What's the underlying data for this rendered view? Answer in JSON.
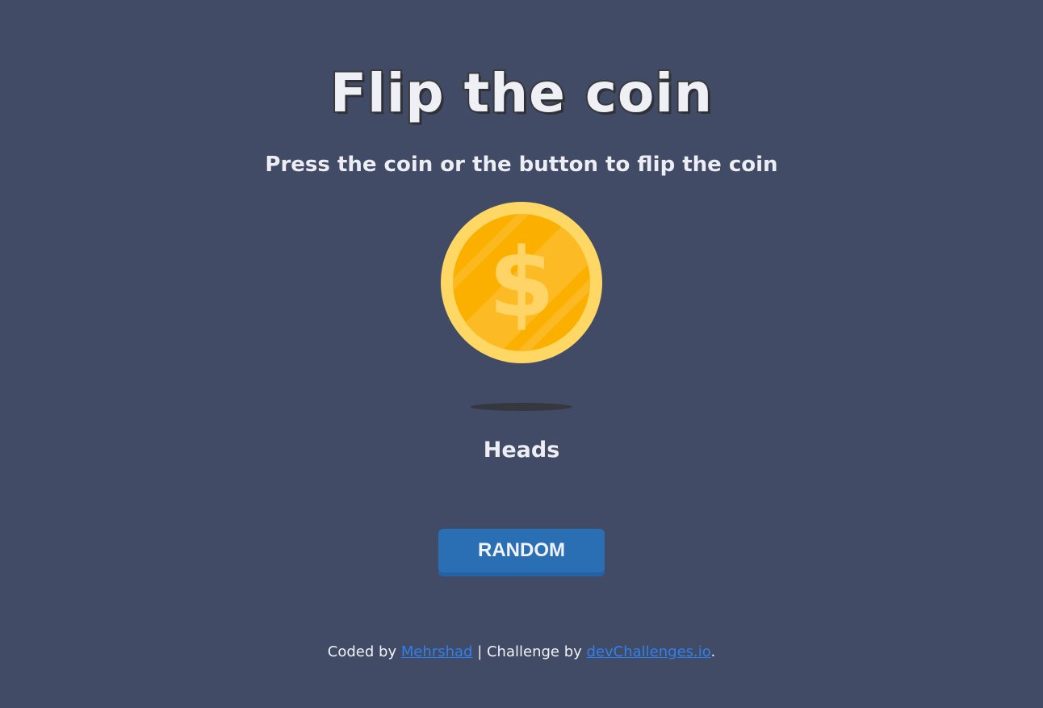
{
  "page": {
    "title": "Flip the coin",
    "subtitle": "Press the coin or the button to flip the coin"
  },
  "coin": {
    "icon": "dollar-coin-icon",
    "face": "heads",
    "symbol": "$"
  },
  "result": {
    "text": "Heads"
  },
  "button": {
    "label": "RANDOM"
  },
  "footer": {
    "coded_by_prefix": "Coded by ",
    "author_link": "Mehrshad",
    "separator": " | Challenge by ",
    "challenge_link": "devChallenges.io",
    "suffix": "."
  },
  "colors": {
    "background": "#414b66",
    "button": "#2a6fb3",
    "link": "#2f80ed",
    "coin_outer": "#ffd764",
    "coin_inner": "#fbb000"
  }
}
